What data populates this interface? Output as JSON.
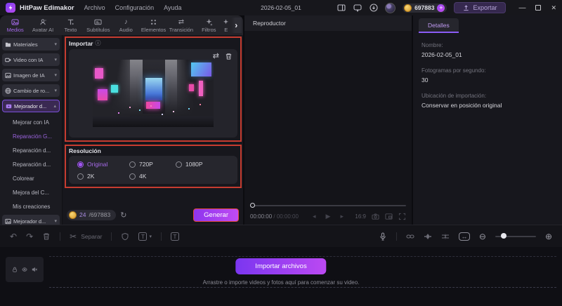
{
  "titlebar": {
    "app_name": "HitPaw Edimakor",
    "menus": [
      "Archivo",
      "Configuración",
      "Ayuda"
    ],
    "project_name": "2026-02-05_01",
    "credits": "697883",
    "export_label": "Exportar"
  },
  "tabs": [
    {
      "label": "Medios",
      "active": true
    },
    {
      "label": "Avatar AI"
    },
    {
      "label": "Texto"
    },
    {
      "label": "Subtítulos"
    },
    {
      "label": "Audio"
    },
    {
      "label": "Elementos"
    },
    {
      "label": "Transición"
    },
    {
      "label": "Filtros"
    }
  ],
  "tabs_overflow_label": "E",
  "sidebar": {
    "groups": [
      {
        "label": "Materiales"
      },
      {
        "label": "Video con IA"
      },
      {
        "label": "Imagen de IA"
      },
      {
        "label": "Cambio de ro..."
      },
      {
        "label": "Mejorador d...",
        "active": true
      },
      {
        "label": "Mejorador d..."
      }
    ],
    "sub_items": [
      {
        "label": "Mejorar con IA"
      },
      {
        "label": "Reparación G...",
        "selected": true
      },
      {
        "label": "Reparación d..."
      },
      {
        "label": "Reparación d..."
      },
      {
        "label": "Colorear"
      },
      {
        "label": "Mejora del C..."
      },
      {
        "label": "Mis creaciones"
      }
    ]
  },
  "importer": {
    "title": "Importar",
    "resolution_title": "Resolución",
    "options": [
      "Original",
      "720P",
      "1080P",
      "2K",
      "4K"
    ],
    "selected_option": "Original",
    "credit_cost": "24",
    "credit_total": "/697883",
    "generate_label": "Generar"
  },
  "player": {
    "title": "Reproductor",
    "time_current": "00:00:00",
    "time_separator": "/",
    "time_total": "00:00:00",
    "aspect_ratio": "16:9"
  },
  "details": {
    "tab_label": "Detalles",
    "fields": [
      {
        "label": "Nombre:",
        "value": "2026-02-05_01"
      },
      {
        "label": "Fotogramas por segundo:",
        "value": "30"
      },
      {
        "label": "Ubicación de importación:",
        "value": "Conservar en posición original"
      }
    ]
  },
  "toolbar": {
    "split_label": "Separar"
  },
  "timeline": {
    "import_button_label": "Importar archivos",
    "hint": "Arrastre o importe videos y fotos aquí para comenzar su video."
  },
  "icons": {
    "info": "ⓘ",
    "swap": "⇄",
    "caret": "▾",
    "chevron": "›",
    "undo": "↶",
    "redo": "↷",
    "scissors": "✂",
    "refresh": "↻",
    "prev": "◂",
    "play": "▶",
    "next": "▸",
    "zoom_out": "⊖",
    "zoom_in": "⊕",
    "fit": "↔",
    "minimize": "—",
    "close": "✕",
    "plus": "+",
    "music_note": "♪",
    "letter_t": "T"
  },
  "colors": {
    "accent_purple": "#8b5cf6",
    "highlight_red": "#c63c30",
    "generate_gradient": [
      "#8d35ee",
      "#c14bf2"
    ],
    "import_gradient": [
      "#7b36f0",
      "#bb49f2"
    ],
    "coin_gold": "#e8b84a"
  }
}
